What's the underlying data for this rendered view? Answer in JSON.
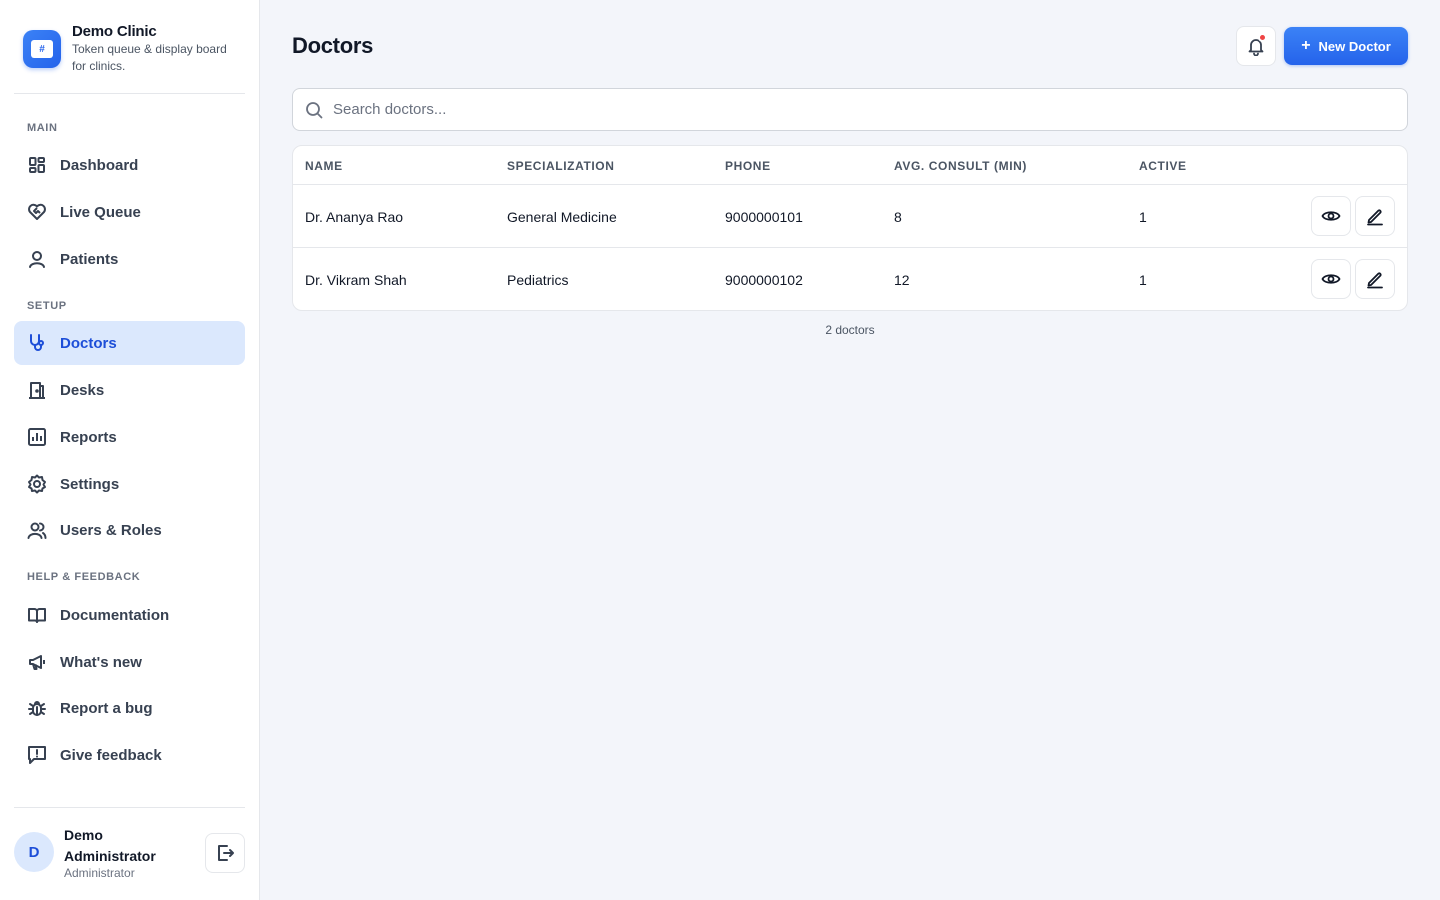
{
  "brand": {
    "name": "Demo Clinic",
    "tagline": "Token queue & display board for clinics.",
    "logo_glyph": "#"
  },
  "sidebar": {
    "sections": {
      "main": "MAIN",
      "setup": "SETUP",
      "help": "HELP & FEEDBACK"
    },
    "items": [
      {
        "label": "Dashboard",
        "icon": "dashboard-icon"
      },
      {
        "label": "Live Queue",
        "icon": "heart-handshake-icon"
      },
      {
        "label": "Patients",
        "icon": "user-icon"
      },
      {
        "label": "Doctors",
        "icon": "stethoscope-icon",
        "active": true
      },
      {
        "label": "Desks",
        "icon": "door-icon"
      },
      {
        "label": "Reports",
        "icon": "bar-chart-icon"
      },
      {
        "label": "Settings",
        "icon": "gear-icon"
      },
      {
        "label": "Users & Roles",
        "icon": "users-icon"
      },
      {
        "label": "Documentation",
        "icon": "book-icon"
      },
      {
        "label": "What's new",
        "icon": "megaphone-icon"
      },
      {
        "label": "Report a bug",
        "icon": "bug-icon"
      },
      {
        "label": "Give feedback",
        "icon": "message-icon"
      }
    ]
  },
  "user": {
    "initial": "D",
    "name": "Demo Administrator",
    "role": "Administrator"
  },
  "header": {
    "title": "Doctors",
    "new_button": "New Doctor"
  },
  "search": {
    "placeholder": "Search doctors...",
    "value": ""
  },
  "table": {
    "columns": [
      "NAME",
      "SPECIALIZATION",
      "PHONE",
      "AVG. CONSULT (MIN)",
      "ACTIVE"
    ],
    "rows": [
      {
        "name": "Dr. Ananya Rao",
        "specialization": "General Medicine",
        "phone": "9000000101",
        "avg_consult": "8",
        "active": "1"
      },
      {
        "name": "Dr. Vikram Shah",
        "specialization": "Pediatrics",
        "phone": "9000000102",
        "avg_consult": "12",
        "active": "1"
      }
    ]
  },
  "footer": {
    "count_text": "2 doctors"
  },
  "colors": {
    "accent": "#2563eb",
    "active_bg": "#dbe8fd",
    "notification_dot": "#ef4444"
  }
}
